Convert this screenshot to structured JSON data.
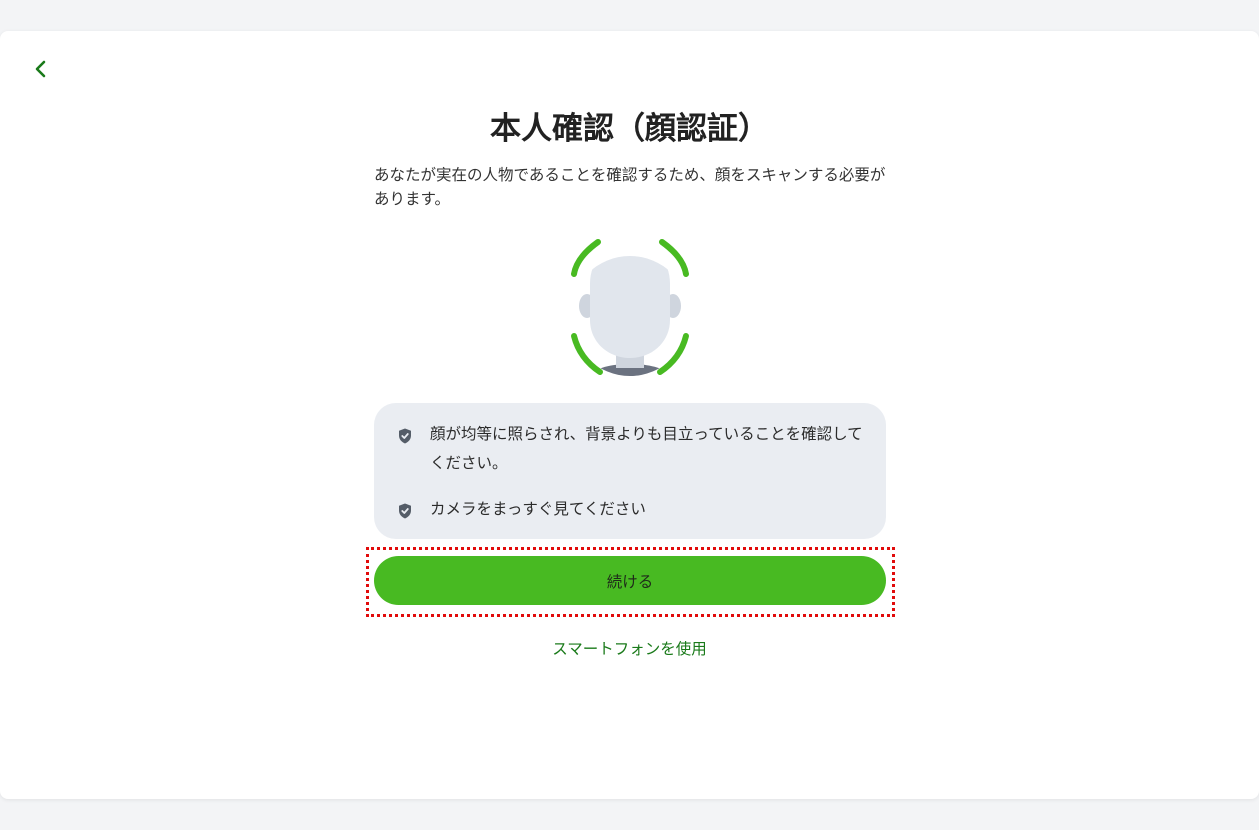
{
  "colors": {
    "accent": "#48ba22",
    "link": "#1a7a1a",
    "highlight": "#e10b0b",
    "tips_background": "#eaedf2"
  },
  "back": {
    "icon": "chevron-left-icon"
  },
  "title": "本人確認（顔認証）",
  "description": "あなたが実在の人物であることを確認するため、顔をスキャンする必要があります。",
  "illustration": {
    "icon": "face-scan-icon"
  },
  "tips": [
    {
      "icon": "shield-check-icon",
      "text": "顔が均等に照らされ、背景よりも目立っていることを確認してください。"
    },
    {
      "icon": "shield-check-icon",
      "text": "カメラをまっすぐ見てください"
    }
  ],
  "continue_label": "続ける",
  "smartphone_label": "スマートフォンを使用"
}
